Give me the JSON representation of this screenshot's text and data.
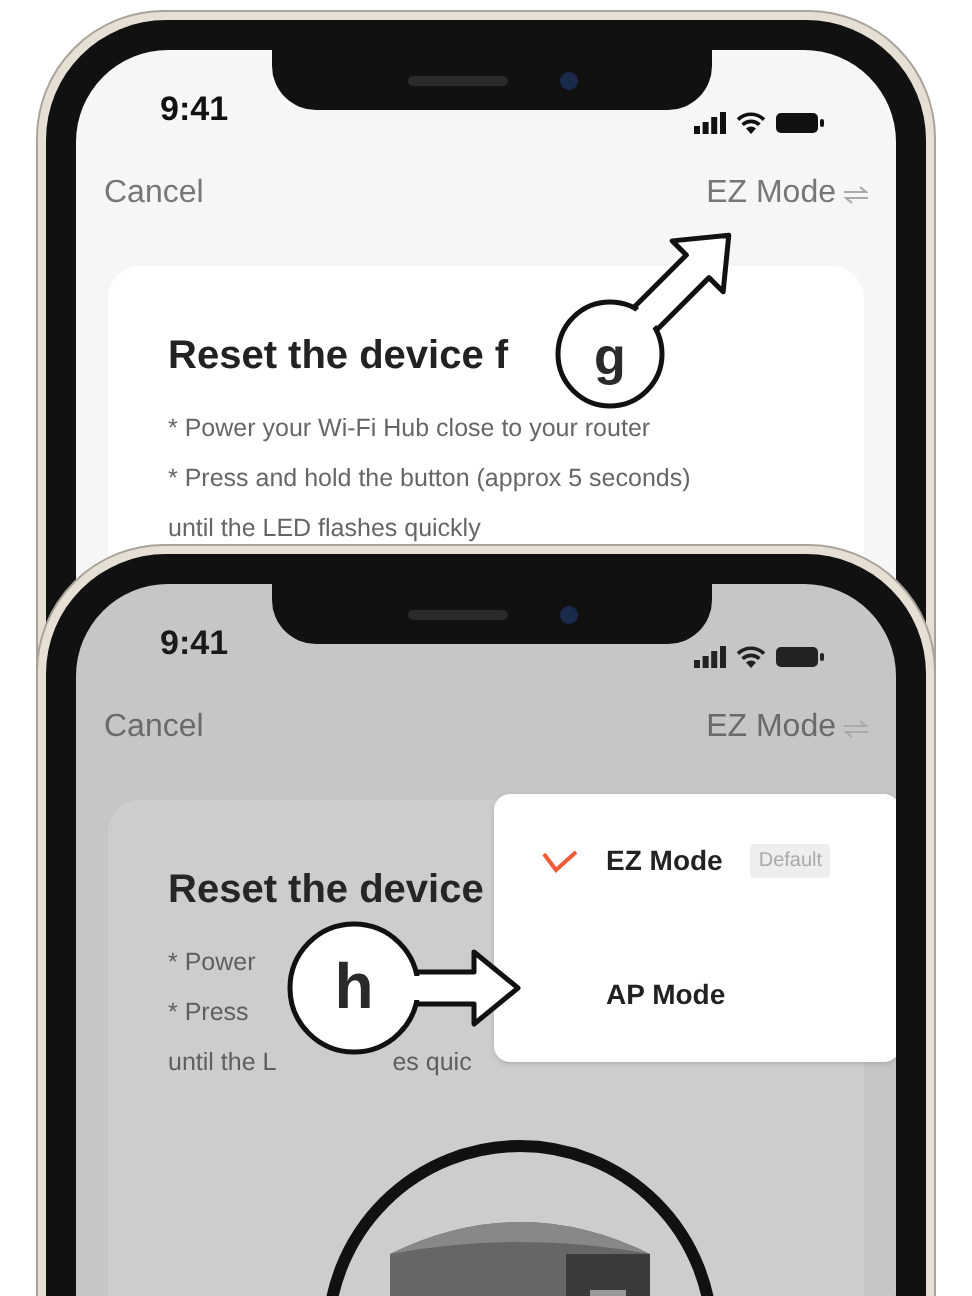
{
  "phones": [
    {
      "time": "9:41",
      "cancel": "Cancel",
      "mode": "EZ Mode",
      "title": "Reset the device f",
      "lines": [
        [
          "* Power your Wi-Fi Hub close to your router"
        ],
        [
          "* Press and hold the button (approx 5 seconds)"
        ],
        [
          "until the LED flashes quickly"
        ]
      ],
      "dimmed": false,
      "callout": {
        "letter": "g"
      }
    },
    {
      "time": "9:41",
      "cancel": "Cancel",
      "mode": "EZ Mode",
      "title": "Reset the device",
      "lines": [
        [
          "* Power"
        ],
        [
          "* Press"
        ],
        [
          "until the L",
          "es quic"
        ]
      ],
      "dimmed": true,
      "menu": {
        "items": [
          {
            "label": "EZ Mode",
            "badge": "Default",
            "selected": true
          },
          {
            "label": "AP Mode",
            "selected": false
          }
        ]
      },
      "callout": {
        "letter": "h"
      },
      "device": {
        "kind": "picture"
      }
    }
  ]
}
